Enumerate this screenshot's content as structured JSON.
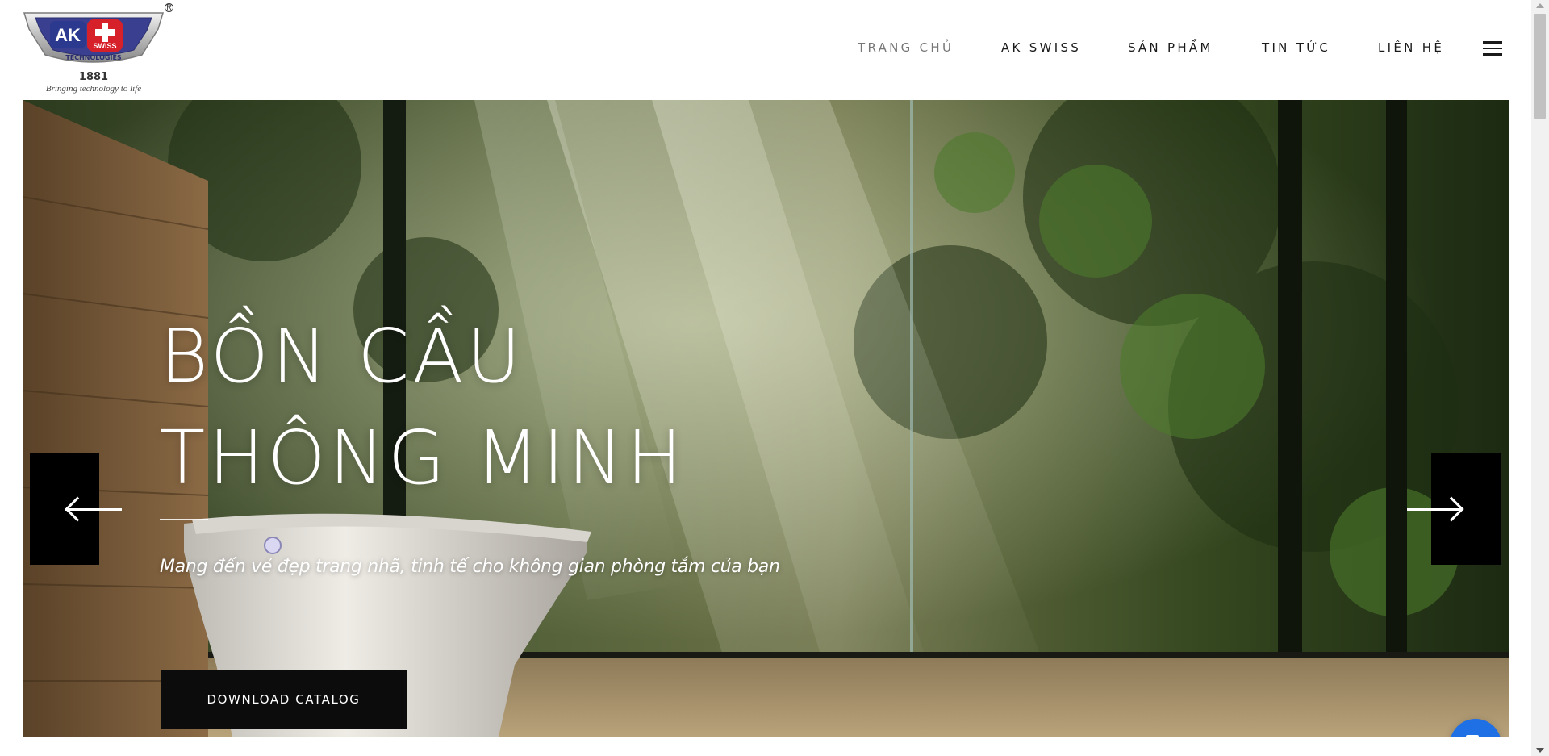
{
  "brand": {
    "logo_text": "AK",
    "logo_badge": "SWISS",
    "logo_arc_text": "TECHNOLOGIES",
    "year": "1881",
    "tagline": "Bringing technology to life",
    "registered_mark": "R"
  },
  "nav": {
    "items": [
      {
        "label": "TRANG CHỦ",
        "active": true
      },
      {
        "label": "AK SWISS",
        "active": false
      },
      {
        "label": "SẢN PHẨM",
        "active": false
      },
      {
        "label": "TIN TỨC",
        "active": false
      },
      {
        "label": "LIÊN HỆ",
        "active": false
      }
    ],
    "menu_icon": "hamburger-menu-icon"
  },
  "hero": {
    "title_line_1": "BỒN CẦU",
    "title_line_2": "THÔNG MINH",
    "subtitle": "Mang đến vẻ đẹp trang nhã, tinh tế cho không gian phòng tắm của bạn",
    "cta_label": "DOWNLOAD CATALOG",
    "prev_icon": "arrow-left-icon",
    "next_icon": "arrow-right-icon"
  },
  "chat": {
    "icon": "chat-bubbles-icon",
    "color": "#1f6fe5"
  },
  "colors": {
    "text_dark": "#1a1a1a",
    "nav_active": "#777777",
    "button_bg": "#0c0c0c",
    "logo_red": "#d6212b",
    "logo_navy": "#2b3a8f"
  }
}
